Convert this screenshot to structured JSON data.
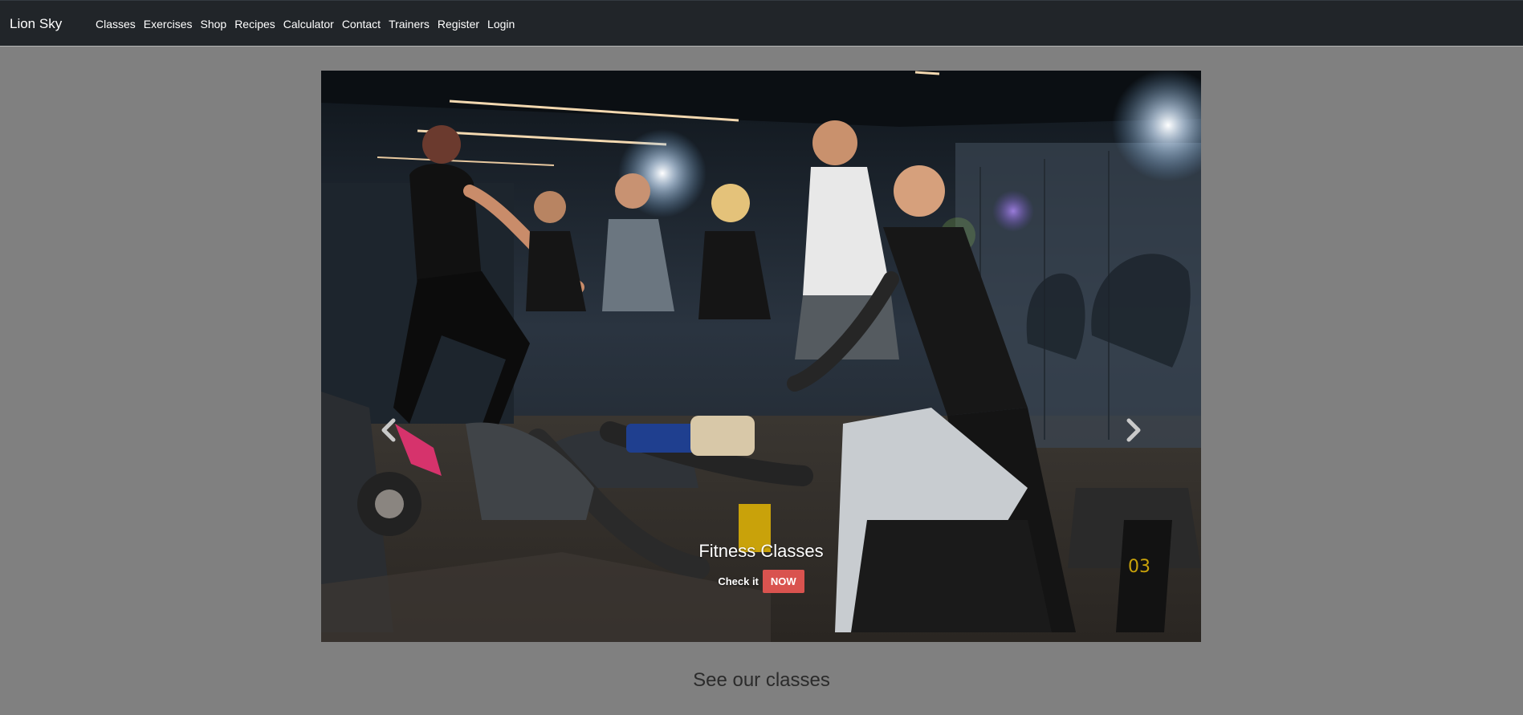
{
  "brand": "Lion Sky",
  "nav": {
    "items": [
      "Classes",
      "Exercises",
      "Shop",
      "Recipes",
      "Calculator",
      "Contact",
      "Trainers",
      "Register",
      "Login"
    ]
  },
  "carousel": {
    "caption_title": "Fitness Classes",
    "check_text": "Check it",
    "cta_label": "NOW",
    "slide_count": 6,
    "active_slide": 1,
    "prev_icon": "chevron-left-icon",
    "next_icon": "chevron-right-icon"
  },
  "section": {
    "heading": "See our classes"
  },
  "colors": {
    "page_bg": "#808080",
    "navbar_bg": "#212529",
    "cta_bg": "#d9534f"
  }
}
